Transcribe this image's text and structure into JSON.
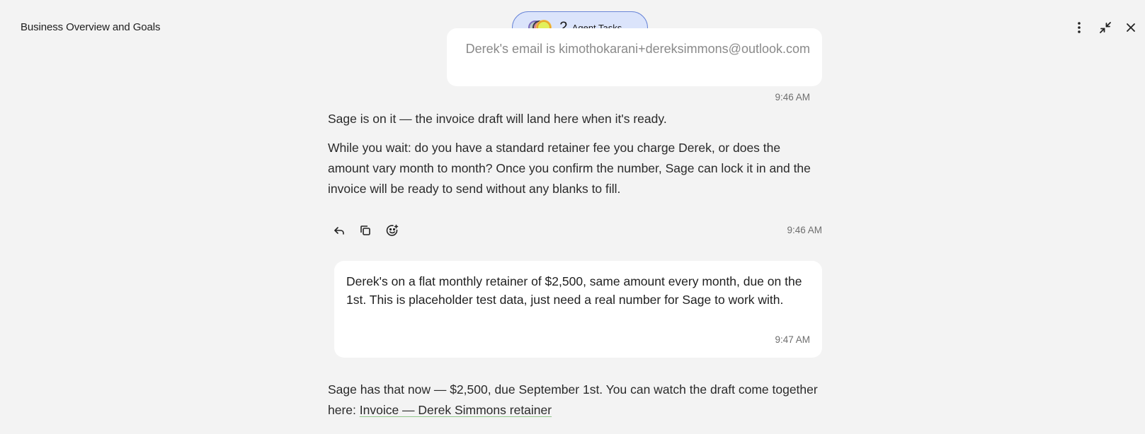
{
  "header": {
    "title": "Business Overview and Goals",
    "agent_tasks": {
      "count": "2",
      "label": "Agent Tasks"
    }
  },
  "icons": {
    "more": "more-vertical-icon",
    "minimize": "collapse-icon",
    "close": "close-icon",
    "reply": "reply-icon",
    "copy": "copy-icon",
    "react": "emoji-add-icon"
  },
  "messages": {
    "user1": {
      "text": "Derek's email is kimothokarani+dereksimmons@outlook.com",
      "time": "9:46 AM"
    },
    "assistant1": {
      "p1": "Sage is on it — the invoice draft will land here when it's ready.",
      "p2": "While you wait: do you have a standard retainer fee you charge Derek, or does the amount vary month to month? Once you confirm the number, Sage can lock it in and the invoice will be ready to send without any blanks to fill.",
      "time": "9:46 AM"
    },
    "user2": {
      "text": "Derek's on a flat monthly retainer of $2,500, same amount every month, due on the 1st. This is placeholder test data, just need a real number for Sage to work with.",
      "time": "9:47 AM"
    },
    "assistant2": {
      "text": "Sage has that now — $2,500, due September 1st. You can watch the draft come together here: ",
      "link": "Invoice — Derek Simmons retainer"
    }
  },
  "colors": {
    "background": "#f3f3f3",
    "bubble": "#ffffff",
    "pill_bg": "#dbe4fb",
    "pill_border": "#6a86d8",
    "link_underline": "#8fc78a"
  }
}
